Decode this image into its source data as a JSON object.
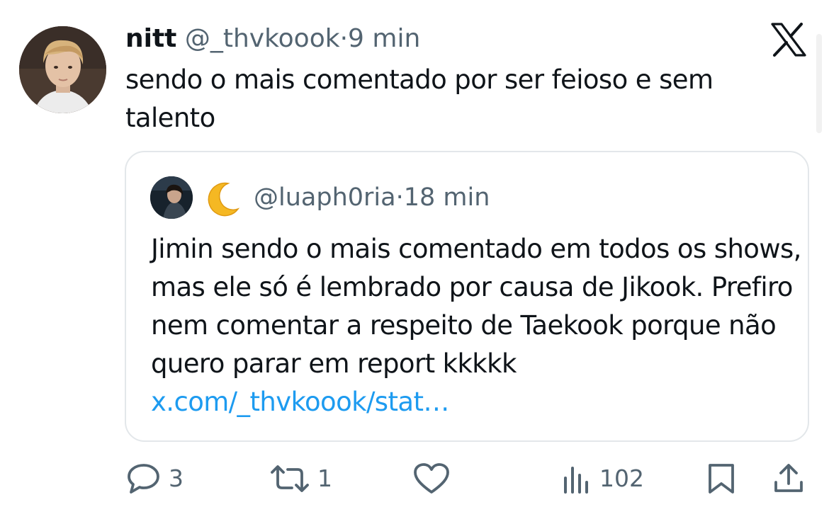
{
  "tweet": {
    "display_name": "nitt",
    "handle": "@_thvkoook",
    "separator": "·",
    "time": "9 min",
    "text": "sendo o mais comentado por ser feioso e sem talento",
    "avatar_icon": "user-photo-avatar"
  },
  "brand": {
    "logo_icon": "x-logo-icon"
  },
  "quote": {
    "emoji_icon": "crescent-moon-emoji",
    "handle": "@luaph0ria",
    "separator": "·",
    "time": "18 min",
    "text": "Jimin sendo o mais comentado em todos os shows, mas ele só é lembrado por causa de Jikook. Prefiro nem comentar a respeito de Taekook porque não quero parar em report kkkkk ",
    "link": "x.com/_thvkoook/stat…"
  },
  "actions": {
    "replies": "3",
    "reposts": "1",
    "likes": "",
    "views": "102",
    "icons": [
      "reply-icon",
      "repost-icon",
      "like-icon",
      "views-icon",
      "bookmark-icon",
      "share-icon"
    ]
  },
  "colors": {
    "text": "#0f1419",
    "secondary": "#536471",
    "link": "#1d9bf0",
    "border": "#e3e7ea"
  }
}
